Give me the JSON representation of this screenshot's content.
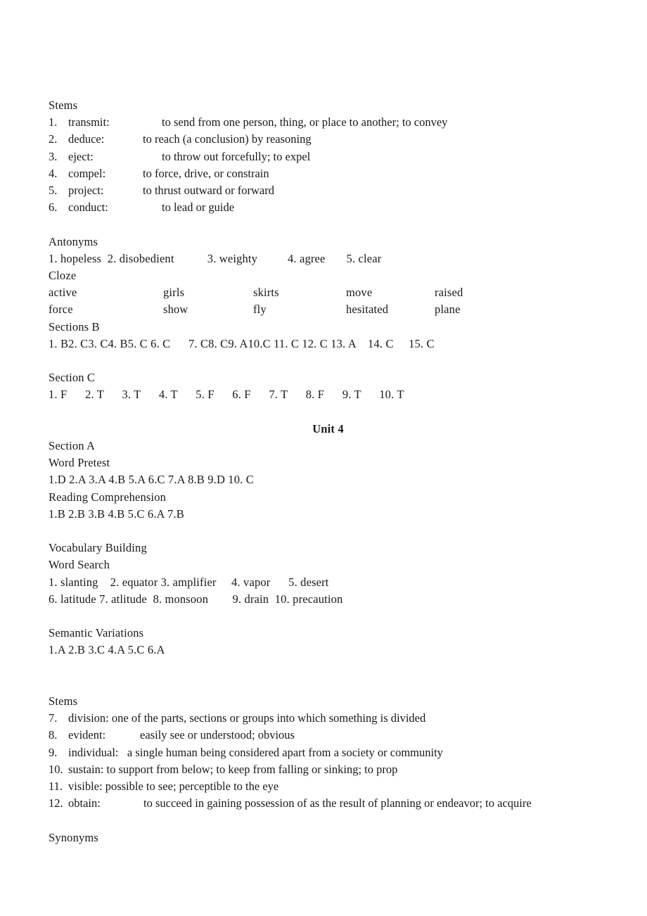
{
  "document": {
    "sections": {
      "stems_unit3": {
        "heading": "Stems",
        "items": [
          {
            "num": "1.",
            "term": "transmit:",
            "term_width": 133,
            "definition": "to send from one person, thing, or place to another; to convey"
          },
          {
            "num": "2.",
            "term": "deduce:",
            "term_width": 106,
            "definition": "to reach (a conclusion) by reasoning"
          },
          {
            "num": "3.",
            "term": "eject:",
            "term_width": 133,
            "definition": "to throw out forcefully; to expel"
          },
          {
            "num": "4.",
            "term": "compel:",
            "term_width": 106,
            "definition": "to force, drive, or constrain"
          },
          {
            "num": "5.",
            "term": "project:",
            "term_width": 106,
            "definition": "to thrust outward or forward"
          },
          {
            "num": "6.",
            "term": "conduct:",
            "term_width": 133,
            "definition": "to lead or guide"
          }
        ]
      },
      "antonyms": {
        "heading": "Antonyms",
        "answers": "1. hopeless  2. disobedient           3. weighty          4. agree       5. clear"
      },
      "cloze": {
        "heading": "Cloze",
        "rows": [
          [
            "active",
            "girls",
            "skirts",
            "move",
            "raised"
          ],
          [
            "force",
            "show",
            "fly",
            "hesitated",
            "plane"
          ]
        ]
      },
      "sections_b": {
        "heading": "Sections B",
        "answers": "1. B2. C3. C4. B5. C 6. C      7. C8. C9. A10.C 11. C 12. C 13. A    14. C     15. C"
      },
      "section_c": {
        "heading": "Section C",
        "answers": "1. F      2. T      3. T      4. T      5. F      6. F      7. T      8. F      9. T      10. T"
      },
      "unit4_title": "Unit 4",
      "unit4_section_a": {
        "heading": "Section A",
        "word_pretest_heading": "Word Pretest",
        "word_pretest_answers": "1.D 2.A 3.A 4.B 5.A 6.C 7.A 8.B 9.D 10. C",
        "reading_comprehension_heading": "Reading Comprehension",
        "reading_comprehension_answers": "1.B 2.B 3.B 4.B 5.C 6.A 7.B"
      },
      "vocabulary_building": {
        "heading": "Vocabulary Building",
        "word_search_heading": "Word Search",
        "word_search_line1": "1. slanting    2. equator 3. amplifier     4. vapor      5. desert",
        "word_search_line2": "6. latitude 7. atlitude  8. monsoon        9. drain  10. precaution"
      },
      "semantic_variations": {
        "heading": "Semantic Variations",
        "answers": "1.A 2.B 3.C 4.A 5.C 6.A"
      },
      "stems_unit4": {
        "heading": "Stems",
        "items": [
          {
            "num": "7.",
            "term": "division:",
            "term_width": 0,
            "definition": "one of the parts, sections or groups into which something is divided"
          },
          {
            "num": "8.",
            "term": "evident:",
            "term_width": 102,
            "definition": "easily see or understood; obvious"
          },
          {
            "num": "9.",
            "term": "individual:",
            "term_width": 0,
            "definition": "a single human being considered apart from a society or community"
          },
          {
            "num": "10.",
            "term": "sustain:",
            "term_width": 0,
            "definition": "to support from below; to keep from falling or sinking; to prop"
          },
          {
            "num": "11.",
            "term": "visible:",
            "term_width": 0,
            "definition": "possible to see; perceptible to the eye"
          },
          {
            "num": "12.",
            "term": "obtain:",
            "term_width": 107,
            "definition": "to succeed in gaining possession of as the result of planning or endeavor; to acquire"
          }
        ]
      },
      "synonyms_heading": "Synonyms"
    }
  }
}
